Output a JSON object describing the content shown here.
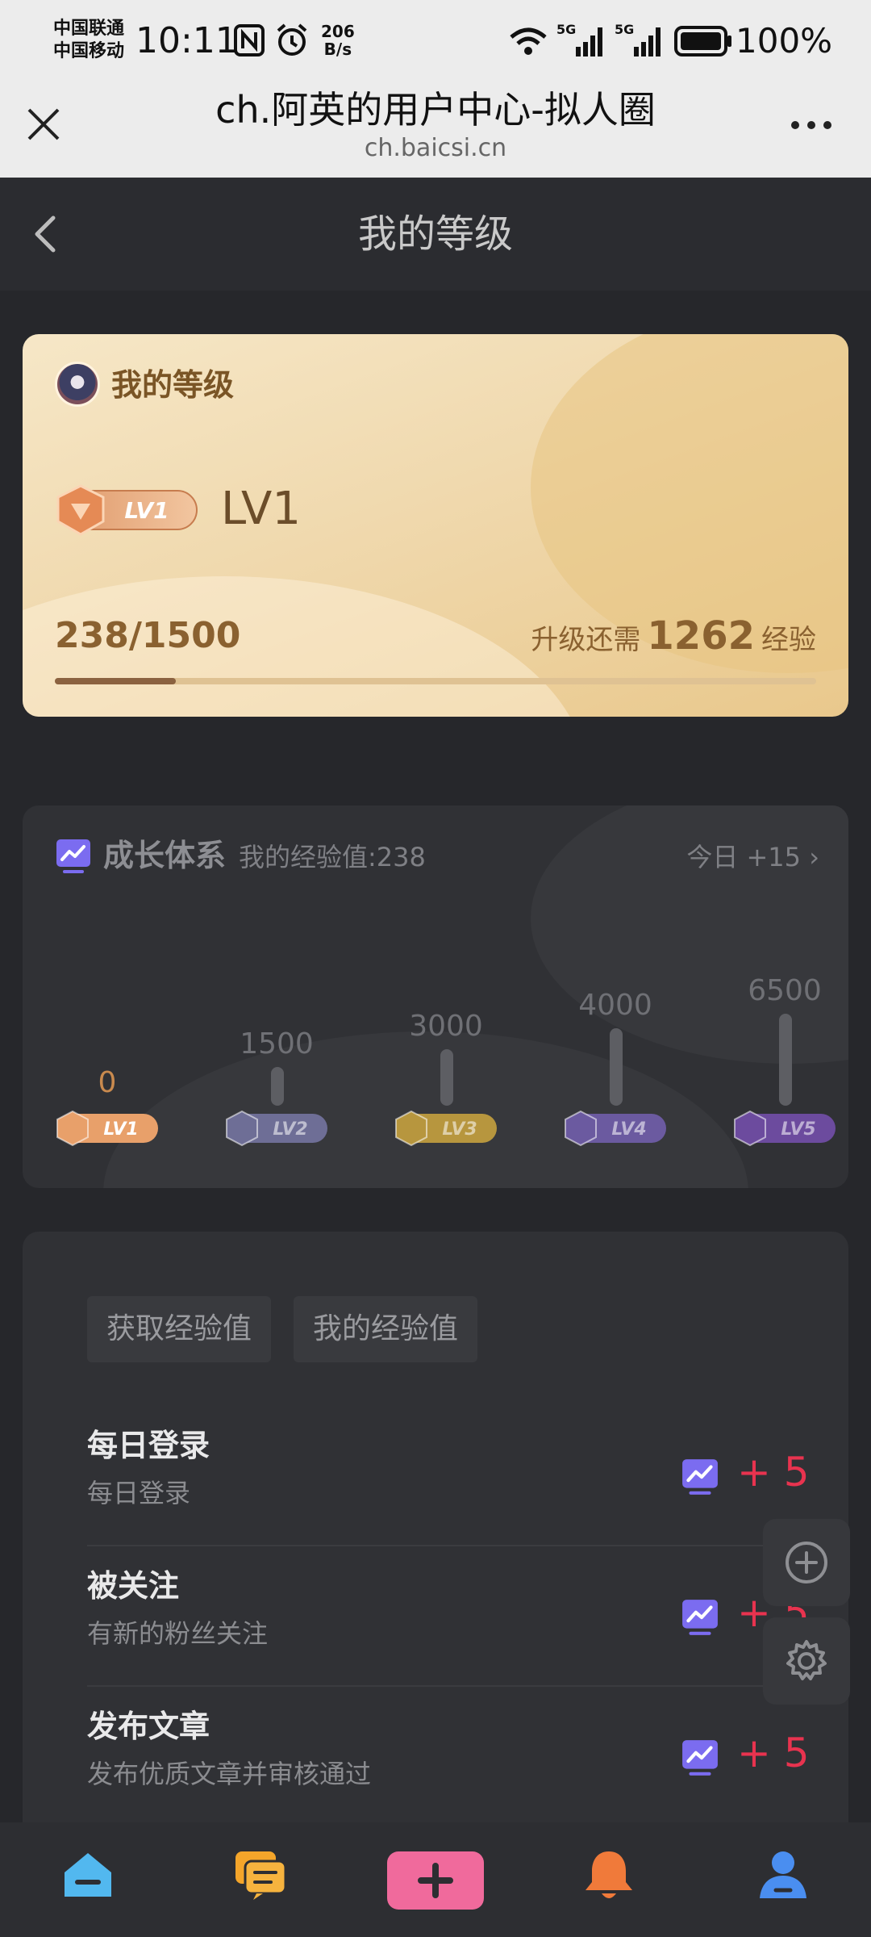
{
  "status_bar": {
    "carrier1": "中国联通",
    "carrier2": "中国移动",
    "time": "10:11",
    "net_speed_value": "206",
    "net_speed_unit": "B/s",
    "battery": "100%",
    "icons": [
      "nfc-icon",
      "alarm-icon",
      "wifi-icon",
      "signal-5g-icon",
      "signal-5g-icon",
      "battery-icon"
    ]
  },
  "browser": {
    "title": "ch.阿英的用户中心-拟人圈",
    "url": "ch.baicsi.cn"
  },
  "header": {
    "title": "我的等级"
  },
  "level_card": {
    "heading": "我的等级",
    "badge_text": "LV1",
    "level": "LV1",
    "progress_text": "238/1500",
    "need_prefix": "升级还需",
    "need_value": "1262",
    "need_suffix": "经验",
    "progress_fraction": 0.159
  },
  "growth": {
    "title": "成长体系",
    "my_exp": "我的经验值:238",
    "today": "今日 +15",
    "levels": [
      {
        "name": "LV1",
        "threshold": "0",
        "color": "#e8a06a"
      },
      {
        "name": "LV2",
        "threshold": "1500",
        "color": "#6e6e96"
      },
      {
        "name": "LV3",
        "threshold": "3000",
        "color": "#b7963e"
      },
      {
        "name": "LV4",
        "threshold": "4000",
        "color": "#6b5aa0"
      },
      {
        "name": "LV5",
        "threshold": "6500",
        "color": "#6c4b9e"
      }
    ]
  },
  "exp": {
    "tabs": [
      "获取经验值",
      "我的经验值"
    ],
    "tasks": [
      {
        "title": "每日登录",
        "desc": "每日登录",
        "points": "+ 5"
      },
      {
        "title": "被关注",
        "desc": "有新的粉丝关注",
        "points": "+ 5"
      },
      {
        "title": "发布文章",
        "desc": "发布优质文章并审核通过",
        "points": "+ 5"
      }
    ]
  },
  "bottom_nav": [
    "home-icon",
    "messages-icon",
    "add-post-icon",
    "notification-icon",
    "profile-icon"
  ],
  "colors": {
    "accent_red": "#e8334f",
    "gold": "#8a6130",
    "purple": "#7b6cf0"
  }
}
